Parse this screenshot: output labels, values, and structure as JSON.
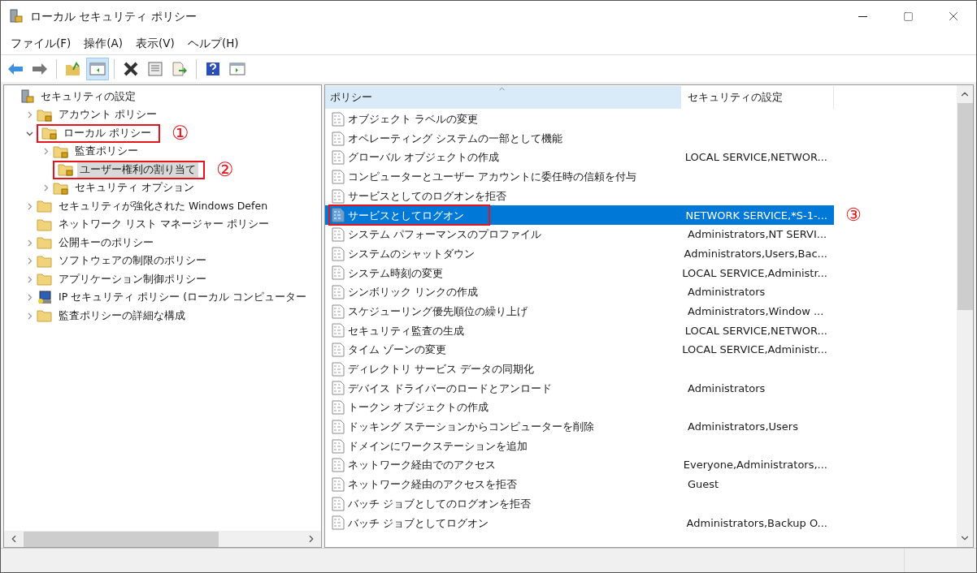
{
  "window": {
    "title": "ローカル セキュリティ ポリシー"
  },
  "menu": [
    "ファイル(F)",
    "操作(A)",
    "表示(V)",
    "ヘルプ(H)"
  ],
  "toolbar": [
    {
      "kind": "back",
      "pressed": false
    },
    {
      "kind": "forward",
      "pressed": false
    },
    {
      "kind": "separator"
    },
    {
      "kind": "up",
      "pressed": false
    },
    {
      "kind": "tree",
      "pressed": true
    },
    {
      "kind": "separator"
    },
    {
      "kind": "delete",
      "pressed": false
    },
    {
      "kind": "properties",
      "pressed": false
    },
    {
      "kind": "export",
      "pressed": false
    },
    {
      "kind": "separator"
    },
    {
      "kind": "help",
      "pressed": false
    },
    {
      "kind": "actions",
      "pressed": false
    }
  ],
  "tree": {
    "label": "セキュリティの設定",
    "kind": "server",
    "selected": false,
    "highlighted": false,
    "children": [
      {
        "label": "アカウント ポリシー",
        "kind": "lockfolder",
        "expanded": false,
        "selected": false,
        "highlighted": false
      },
      {
        "label": "ローカル ポリシー",
        "kind": "lockfolder",
        "expanded": true,
        "selected": false,
        "highlighted": true,
        "annotation": "①",
        "children": [
          {
            "label": "監査ポリシー",
            "kind": "lockfolder",
            "expanded": false,
            "selected": false,
            "highlighted": false
          },
          {
            "label": "ユーザー権利の割り当て",
            "kind": "lockfolder",
            "selected": true,
            "highlighted": true,
            "annotation": "②"
          },
          {
            "label": "セキュリティ オプション",
            "kind": "lockfolder",
            "expanded": false,
            "selected": false,
            "highlighted": false
          }
        ]
      },
      {
        "label": "セキュリティが強化された Windows Defen",
        "kind": "folder",
        "expanded": false,
        "selected": false,
        "highlighted": false
      },
      {
        "label": "ネットワーク リスト マネージャー ポリシー",
        "kind": "folder",
        "selected": false,
        "highlighted": false
      },
      {
        "label": "公開キーのポリシー",
        "kind": "folder",
        "expanded": false,
        "selected": false,
        "highlighted": false
      },
      {
        "label": "ソフトウェアの制限のポリシー",
        "kind": "folder",
        "expanded": false,
        "selected": false,
        "highlighted": false
      },
      {
        "label": "アプリケーション制御ポリシー",
        "kind": "folder",
        "expanded": false,
        "selected": false,
        "highlighted": false
      },
      {
        "label": "IP セキュリティ ポリシー (ローカル コンピューター",
        "kind": "computer",
        "expanded": false,
        "selected": false,
        "highlighted": false
      },
      {
        "label": "監査ポリシーの詳細な構成",
        "kind": "folder",
        "expanded": false,
        "selected": false,
        "highlighted": false
      }
    ]
  },
  "table": {
    "columns": [
      "ポリシー",
      "セキュリティの設定"
    ],
    "rows": [
      {
        "policy": "オブジェクト ラベルの変更",
        "setting": "",
        "selected": false,
        "highlighted": false
      },
      {
        "policy": "オペレーティング システムの一部として機能",
        "setting": "",
        "selected": false,
        "highlighted": false
      },
      {
        "policy": "グローバル オブジェクトの作成",
        "setting": "LOCAL SERVICE,NETWOR...",
        "selected": false,
        "highlighted": false
      },
      {
        "policy": "コンピューターとユーザー アカウントに委任時の信頼を付与",
        "setting": "",
        "selected": false,
        "highlighted": false
      },
      {
        "policy": "サービスとしてのログオンを拒否",
        "setting": "",
        "selected": false,
        "highlighted": false
      },
      {
        "policy": "サービスとしてログオン",
        "setting": "NETWORK SERVICE,*S-1-...",
        "selected": true,
        "highlighted": true,
        "annotation": "③"
      },
      {
        "policy": "システム パフォーマンスのプロファイル",
        "setting": "Administrators,NT SERVI...",
        "selected": false,
        "highlighted": false
      },
      {
        "policy": "システムのシャットダウン",
        "setting": "Administrators,Users,Bac...",
        "selected": false,
        "highlighted": false
      },
      {
        "policy": "システム時刻の変更",
        "setting": "LOCAL SERVICE,Administr...",
        "selected": false,
        "highlighted": false
      },
      {
        "policy": "シンボリック リンクの作成",
        "setting": "Administrators",
        "selected": false,
        "highlighted": false
      },
      {
        "policy": "スケジューリング優先順位の繰り上げ",
        "setting": "Administrators,Window ...",
        "selected": false,
        "highlighted": false
      },
      {
        "policy": "セキュリティ監査の生成",
        "setting": "LOCAL SERVICE,NETWOR...",
        "selected": false,
        "highlighted": false
      },
      {
        "policy": "タイム ゾーンの変更",
        "setting": "LOCAL SERVICE,Administr...",
        "selected": false,
        "highlighted": false
      },
      {
        "policy": "ディレクトリ サービス データの同期化",
        "setting": "",
        "selected": false,
        "highlighted": false
      },
      {
        "policy": "デバイス ドライバーのロードとアンロード",
        "setting": "Administrators",
        "selected": false,
        "highlighted": false
      },
      {
        "policy": "トークン オブジェクトの作成",
        "setting": "",
        "selected": false,
        "highlighted": false
      },
      {
        "policy": "ドッキング ステーションからコンピューターを削除",
        "setting": "Administrators,Users",
        "selected": false,
        "highlighted": false
      },
      {
        "policy": "ドメインにワークステーションを追加",
        "setting": "",
        "selected": false,
        "highlighted": false
      },
      {
        "policy": "ネットワーク経由でのアクセス",
        "setting": "Everyone,Administrators,...",
        "selected": false,
        "highlighted": false
      },
      {
        "policy": "ネットワーク経由のアクセスを拒否",
        "setting": "Guest",
        "selected": false,
        "highlighted": false
      },
      {
        "policy": "バッチ ジョブとしてのログオンを拒否",
        "setting": "",
        "selected": false,
        "highlighted": false
      },
      {
        "policy": "バッチ ジョブとしてログオン",
        "setting": "Administrators,Backup O...",
        "selected": false,
        "highlighted": false
      }
    ]
  }
}
